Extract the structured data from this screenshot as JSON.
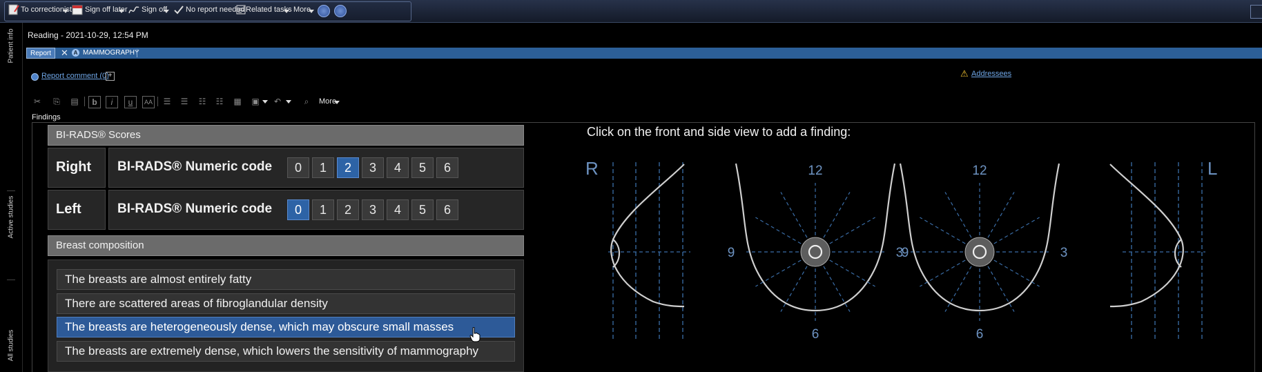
{
  "toolbar": {
    "to_correctionist": "To correctionist",
    "sign_off_later": "Sign off later",
    "sign_off": "Sign off",
    "no_report_needed": "No report needed",
    "related_tasks": "Related tasks",
    "more": "More"
  },
  "rail": {
    "patient_info": "Patient info",
    "active_studies": "Active studies",
    "all_studies": "All studies"
  },
  "header": {
    "reading_title": "Reading - 2021-10-29, 12:54 PM",
    "tabs": [
      {
        "label": "Report",
        "active": true
      },
      {
        "badge": "A",
        "label": "MAMMOGRAPHY",
        "active": false
      }
    ],
    "report_comment_link": "Report comment (0)",
    "addressees_link": "Addressees"
  },
  "editor_toolbar": {
    "more_label": "More",
    "icons": [
      "cut-icon",
      "copy-icon",
      "paste-icon",
      "bold-icon",
      "italic-icon",
      "underline-icon",
      "font-size-icon",
      "align-left-icon",
      "align-right-icon",
      "bullet-list-icon",
      "numbered-list-icon",
      "table-icon",
      "insert-icon",
      "undo-icon",
      "spellcheck-icon"
    ]
  },
  "findings": {
    "label": "Findings",
    "birads_header": "BI-RADS® Scores",
    "rows": [
      {
        "side": "Right",
        "code_label": "BI-RADS® Numeric code",
        "options": [
          "0",
          "1",
          "2",
          "3",
          "4",
          "5",
          "6"
        ],
        "selected": "2"
      },
      {
        "side": "Left",
        "code_label": "BI-RADS® Numeric code",
        "options": [
          "0",
          "1",
          "2",
          "3",
          "4",
          "5",
          "6"
        ],
        "selected": "0"
      }
    ],
    "composition_header": "Breast composition",
    "composition_options": [
      "The breasts are almost entirely fatty",
      "There are scattered areas of fibroglandular density",
      "The breasts are heterogeneously dense, which may obscure small masses",
      "The breasts are extremely dense, which lowers the sensitivity of mammography"
    ],
    "composition_selected": 2
  },
  "diagram": {
    "instruction": "Click on the front and side view to add a finding:",
    "right_marker": "R",
    "left_marker": "L",
    "clock_labels": {
      "top": "12",
      "bottom": "6",
      "left": "9",
      "right": "3"
    },
    "colors": {
      "guide": "#3b6ea8",
      "outline": "#cfcfcf",
      "text": "#6d93c2"
    }
  },
  "colors": {
    "selected": "#2d63a6",
    "link": "#6fa6e6",
    "tabbar": "#2c5f98",
    "warning": "#f2c230"
  }
}
